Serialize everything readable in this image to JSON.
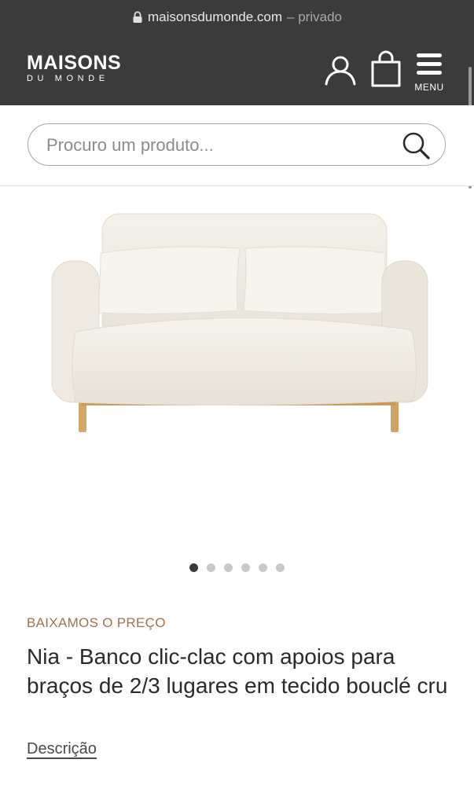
{
  "browser": {
    "url": "maisonsdumonde.com",
    "privacy_label": "– privado"
  },
  "header": {
    "logo_line1": "MAISONS",
    "logo_line2": "DU MONDE",
    "menu_label": "MENU",
    "background": "#3b3b3b"
  },
  "search": {
    "placeholder": "Procuro um produto..."
  },
  "gallery": {
    "dots_count": 6,
    "active_index": 0
  },
  "product": {
    "promo_label": "BAIXAMOS O PREÇO",
    "title": "Nia - Banco clic-clac com apoios para braços de 2/3 lugares em tecido bouclé cru",
    "description_link": "Descrição",
    "promo_color": "#9a7550"
  }
}
